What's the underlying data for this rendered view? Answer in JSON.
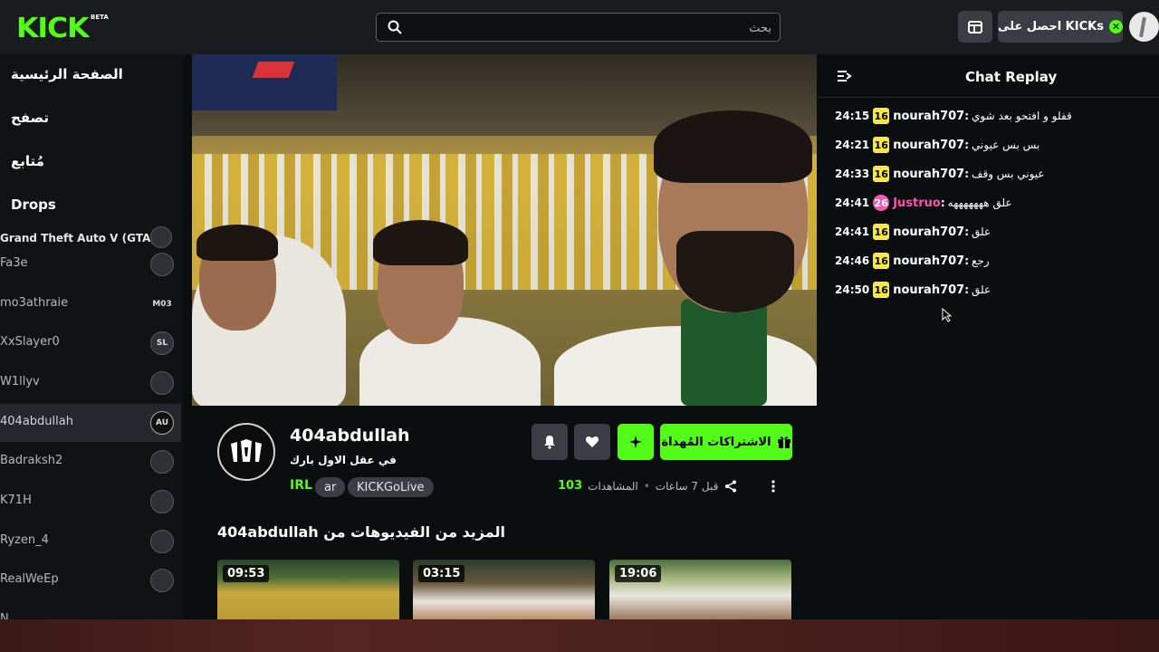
{
  "header": {
    "logo": "KICK",
    "beta": "BETA",
    "search_placeholder": "بحث",
    "kicks_button": "احصل على KICKs"
  },
  "sidebar": {
    "nav": [
      "الصفحة الرئيسية",
      "تصفح",
      "مُتابع",
      "Drops"
    ],
    "channels": [
      {
        "name": "Grand Theft Auto V (GTA)",
        "avatar": ""
      },
      {
        "name": "Fa3e",
        "avatar": ""
      },
      {
        "name": "mo3athraie",
        "avatar": "M03"
      },
      {
        "name": "XxSlayer0",
        "avatar": "SL"
      },
      {
        "name": "W1llyv",
        "avatar": ""
      },
      {
        "name": "404abdullah",
        "avatar": "AU"
      },
      {
        "name": "Badraksh2",
        "avatar": ""
      },
      {
        "name": "K71H",
        "avatar": ""
      },
      {
        "name": "Ryzen_4",
        "avatar": ""
      },
      {
        "name": "RealWeEp",
        "avatar": ""
      },
      {
        "name": "N",
        "avatar": ""
      }
    ]
  },
  "chat": {
    "title": "Chat Replay",
    "messages": [
      {
        "time": "24:15",
        "badge": "16",
        "user": "nourah707",
        "text": "قفلو و افتحو بعد شوي"
      },
      {
        "time": "24:21",
        "badge": "16",
        "user": "nourah707",
        "text": "بس بس عيوني"
      },
      {
        "time": "24:33",
        "badge": "16",
        "user": "nourah707",
        "text": "عيوني بس وقف"
      },
      {
        "time": "24:41",
        "badge": "26",
        "user": "Justruo",
        "text": "علق هههههههه"
      },
      {
        "time": "24:41",
        "badge": "16",
        "user": "nourah707",
        "text": "علق"
      },
      {
        "time": "24:46",
        "badge": "16",
        "user": "nourah707",
        "text": "رجع"
      },
      {
        "time": "24:50",
        "badge": "16",
        "user": "nourah707",
        "text": "علق"
      }
    ]
  },
  "channel": {
    "name": "404abdullah",
    "title": "في عقل الاول بارك",
    "category": "IRL",
    "tags": [
      "ar",
      "KICKGoLive"
    ],
    "subscribe_label": "الاشتراكات المُهداة",
    "views": "103",
    "views_label": "المشاهدات",
    "time_ago": "قبل 7 ساعات"
  },
  "more_videos": {
    "title": "المزيد من الفيديوهات من 404abdullah",
    "items": [
      {
        "duration": "09:53"
      },
      {
        "duration": "03:15"
      },
      {
        "duration": "19:06"
      }
    ]
  },
  "colors": {
    "accent": "#53fc18",
    "badge": "#f7e94a",
    "badge_pink": "#f05ab6",
    "user_pink": "#ff4fb3"
  }
}
